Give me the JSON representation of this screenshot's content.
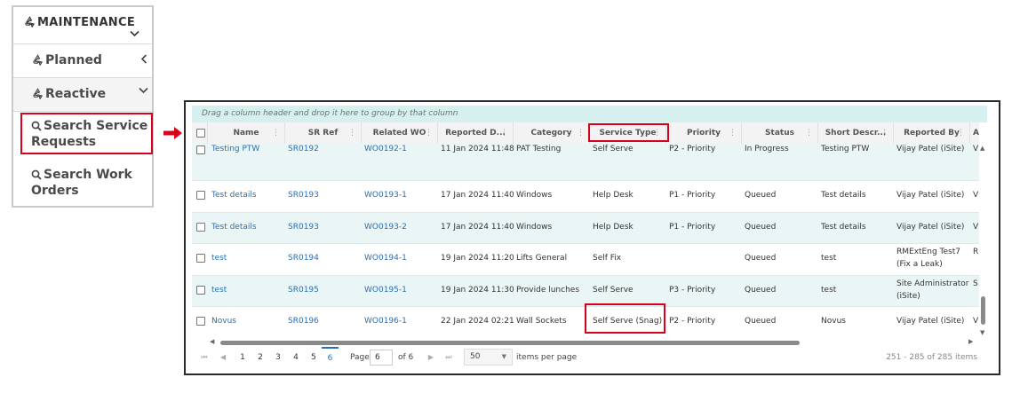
{
  "menu": {
    "title": "MAINTENANCE",
    "planned": "Planned",
    "reactive": "Reactive",
    "search_sr": [
      "Search Service",
      "Requests"
    ],
    "search_wo": [
      "Search Work",
      "Orders"
    ]
  },
  "grid": {
    "group_hint": "Drag a column header and drop it here to group by that column",
    "columns": [
      "Name",
      "SR Ref",
      "Related WO",
      "Reported D...",
      "Category",
      "Service Type",
      "Priority",
      "Status",
      "Short Descr...",
      "Reported By",
      "A"
    ],
    "rows": [
      {
        "name": "Testing PTW",
        "sr": "SR0192",
        "wo": "WO0192-1",
        "date": "11 Jan 2024 11:48",
        "category": "PAT Testing",
        "service": "Self Serve",
        "priority": "P2 - Priority",
        "status": "In Progress",
        "desc": "Testing PTW",
        "by": [
          "Vijay Patel (iSite)"
        ],
        "extra": "V"
      },
      {
        "name": "Test details",
        "sr": "SR0193",
        "wo": "WO0193-1",
        "date": "17 Jan 2024 11:40",
        "category": "Windows",
        "service": "Help Desk",
        "priority": "P1 - Priority",
        "status": "Queued",
        "desc": "Test details",
        "by": [
          "Vijay Patel (iSite)"
        ],
        "extra": "V"
      },
      {
        "name": "Test details",
        "sr": "SR0193",
        "wo": "WO0193-2",
        "date": "17 Jan 2024 11:40",
        "category": "Windows",
        "service": "Help Desk",
        "priority": "P1 - Priority",
        "status": "Queued",
        "desc": "Test details",
        "by": [
          "Vijay Patel (iSite)"
        ],
        "extra": "V"
      },
      {
        "name": "test",
        "sr": "SR0194",
        "wo": "WO0194-1",
        "date": "19 Jan 2024 11:20",
        "category": "Lifts General",
        "service": "Self Fix",
        "priority": "",
        "status": "Queued",
        "desc": "test",
        "by": [
          "RMExtEng Test7",
          "(Fix a Leak)"
        ],
        "extra": "R"
      },
      {
        "name": "test",
        "sr": "SR0195",
        "wo": "WO0195-1",
        "date": "19 Jan 2024 11:30",
        "category": "Provide lunches",
        "service": "Self Serve",
        "priority": "P3 - Priority",
        "status": "Queued",
        "desc": "test",
        "by": [
          "Site Administrator",
          "(iSite)"
        ],
        "extra": "S"
      },
      {
        "name": "Novus",
        "sr": "SR0196",
        "wo": "WO0196-1",
        "date": "22 Jan 2024 02:21",
        "category": "Wall Sockets",
        "service": "Self Serve (Snag)",
        "priority": "P2 - Priority",
        "status": "Queued",
        "desc": "Novus",
        "by": [
          "Vijay Patel (iSite)"
        ],
        "extra": "V"
      }
    ]
  },
  "pager": {
    "pages": [
      "1",
      "2",
      "3",
      "4",
      "5",
      "6"
    ],
    "selected": "6",
    "page_label": "Page",
    "page_value": "6",
    "of_label": "of 6",
    "per_page_value": "50",
    "per_page_label": "items per page",
    "info": "251 - 285 of 285 items"
  },
  "colors": {
    "highlight": "#d9001b",
    "link": "#2a6fb0",
    "alt_row": "#eaf6f6",
    "group_bar": "#d6f0f0"
  }
}
